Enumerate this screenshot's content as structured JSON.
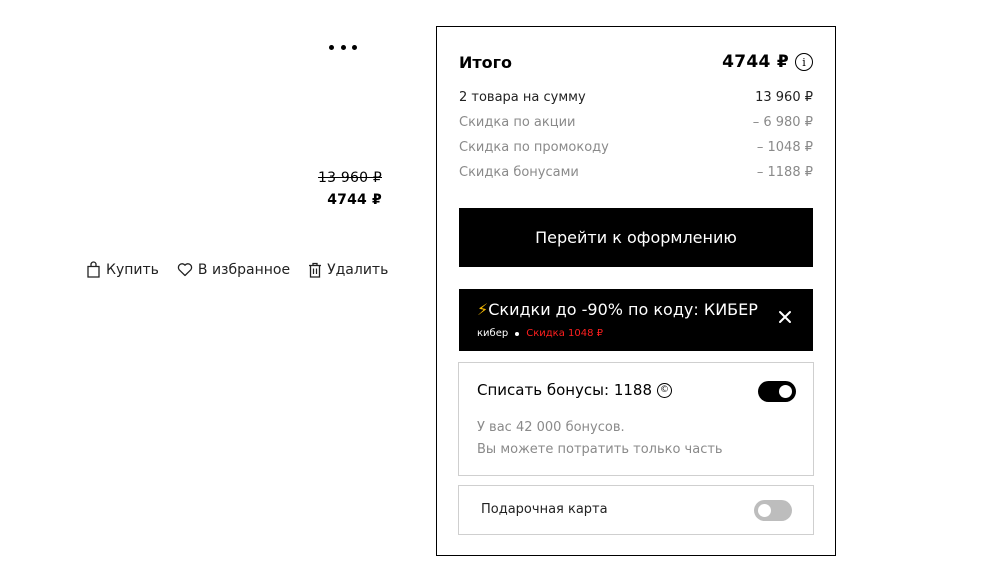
{
  "item": {
    "old_price": "13 960 ₽",
    "new_price": "4744 ₽",
    "actions": {
      "buy_label": "Купить",
      "favorite_label": "В избранное",
      "delete_label": "Удалить"
    }
  },
  "summary": {
    "total_label": "Итого",
    "total_amount": "4744 ₽",
    "info_glyph": "i",
    "lines": [
      {
        "label": "2 товара на сумму",
        "value": "13 960 ₽"
      },
      {
        "label": "Скидка по акции",
        "value": "– 6 980 ₽"
      },
      {
        "label": "Скидка по промокоду",
        "value": "– 1048 ₽"
      },
      {
        "label": "Скидка бонусами",
        "value": "– 1188 ₽"
      }
    ],
    "checkout_label": "Перейти к оформлению"
  },
  "promo": {
    "icon": "lightning-icon",
    "bolt": "⚡",
    "title": "Скидки до -90% по коду: КИБЕР",
    "code": "кибер",
    "discount": "Скидка 1048 ₽"
  },
  "bonus": {
    "title": "Списать бонусы: 1188",
    "coin_glyph": "©",
    "enabled": true,
    "note_line1": "У вас 42 000 бонусов.",
    "note_line2": "Вы можете потратить только часть"
  },
  "gift_card": {
    "label": "Подарочная карта",
    "enabled": false
  },
  "colors": {
    "accent": "#000000",
    "muted_text": "#8a8a8a",
    "promo_discount": "#ff1f1f",
    "bolt": "#f5b800",
    "toggle_off": "#bdbdbd"
  }
}
